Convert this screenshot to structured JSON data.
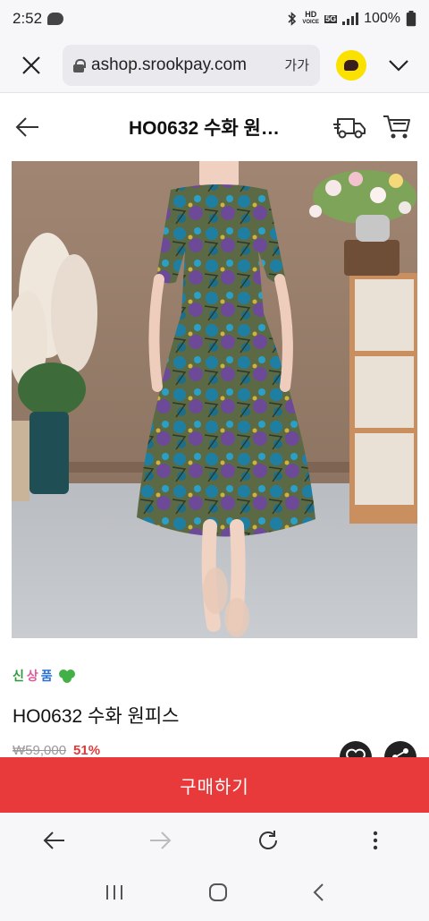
{
  "status_bar": {
    "time": "2:52",
    "net_top": "HD",
    "net_bottom": "VOICE",
    "net_5g": "5G",
    "battery": "100%"
  },
  "browser": {
    "url": "ashop.srookpay.com",
    "text_size_label": "가가"
  },
  "page": {
    "title": "HO0632 수화 원…"
  },
  "product": {
    "badge": [
      "신",
      "상",
      "품"
    ],
    "name": "HO0632 수화 원피스",
    "old_price": "₩59,000",
    "discount": "51%"
  },
  "buy_button": {
    "label": "구매하기"
  },
  "colors": {
    "accent": "#e83a3a",
    "kakao": "#fae100"
  }
}
